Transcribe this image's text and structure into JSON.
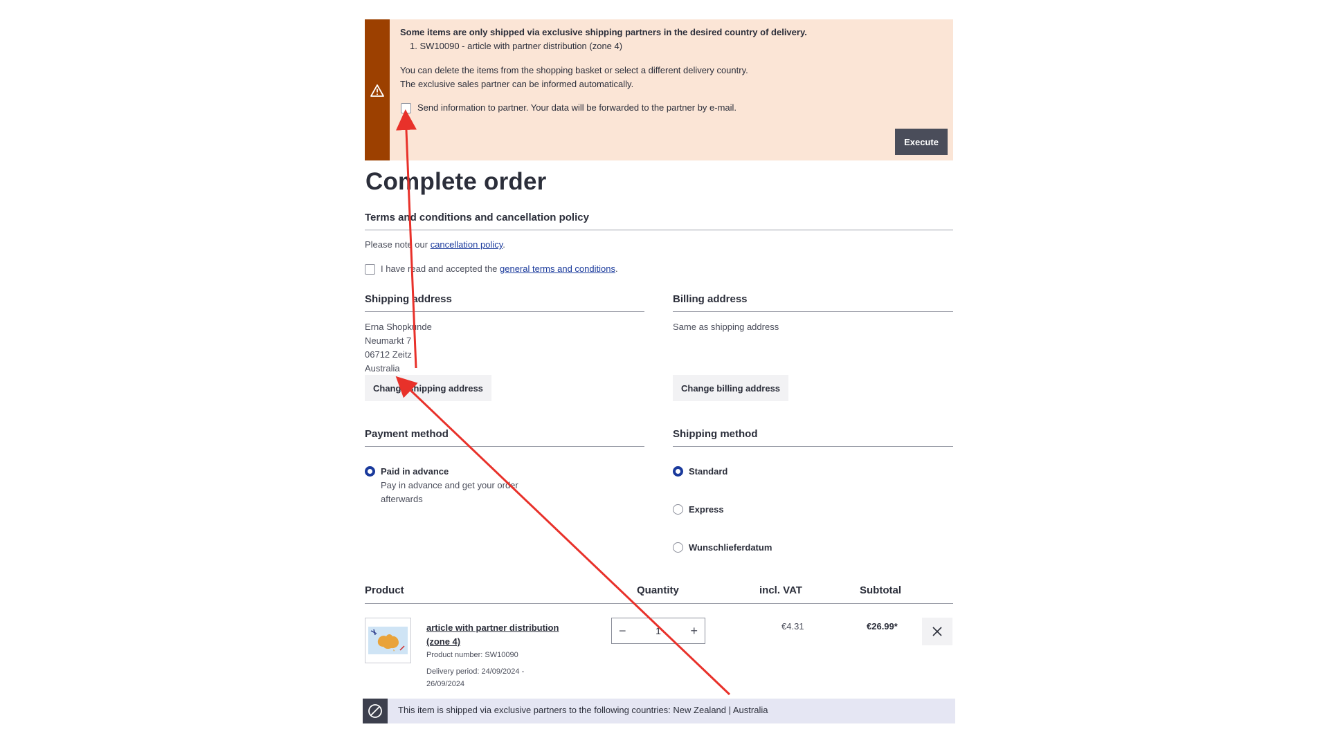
{
  "warning": {
    "title": "Some items are only shipped via exclusive shipping partners in the desired country of delivery.",
    "item": "1. SW10090 - article with partner distribution (zone 4)",
    "line1": "You can delete the items from the shopping basket or select a different delivery country.",
    "line2": "The exclusive sales partner can be informed automatically.",
    "checkbox_label": "Send information to partner. Your data will be forwarded to the partner by e-mail.",
    "execute_label": "Execute",
    "bar_color": "#9c4000",
    "bg_color": "#fbe5d6"
  },
  "page_title": "Complete order",
  "terms": {
    "heading": "Terms and conditions and cancellation policy",
    "note_prefix": "Please note our ",
    "note_link": "cancellation policy",
    "note_suffix": ".",
    "accept_prefix": "I have read and accepted the ",
    "accept_link": "general terms and conditions",
    "accept_suffix": "."
  },
  "shipping_address": {
    "heading": "Shipping address",
    "name": "Erna Shopkunde",
    "street": "Neumarkt 7",
    "city": "06712 Zeitz",
    "country": "Australia",
    "change_label": "Change shipping address"
  },
  "billing_address": {
    "heading": "Billing address",
    "text": "Same as shipping address",
    "change_label": "Change billing address"
  },
  "payment": {
    "heading": "Payment method",
    "options": [
      {
        "label": "Paid in advance",
        "desc1": "Pay in advance and get your order",
        "desc2": "afterwards",
        "selected": true
      }
    ]
  },
  "shipping_method": {
    "heading": "Shipping method",
    "options": [
      {
        "label": "Standard",
        "selected": true
      },
      {
        "label": "Express",
        "selected": false
      },
      {
        "label": "Wunschlieferdatum",
        "selected": false
      }
    ]
  },
  "table": {
    "headers": {
      "product": "Product",
      "quantity": "Quantity",
      "vat": "incl. VAT",
      "subtotal": "Subtotal"
    },
    "rows": [
      {
        "name_line1": "article with partner distribution",
        "name_line2": "(zone 4)",
        "product_number": "Product number: SW10090",
        "delivery_line1": "Delivery period: 24/09/2024 -",
        "delivery_line2": "26/09/2024",
        "quantity": "1",
        "vat": "€4.31",
        "subtotal": "€26.99*"
      }
    ]
  },
  "notice": {
    "text": "This item is shipped via exclusive partners to the following countries: New Zealand | Australia"
  },
  "colors": {
    "accent": "#1a3a9c",
    "annotation_arrow": "#e8312a",
    "button_dark": "#4a4d5a"
  }
}
